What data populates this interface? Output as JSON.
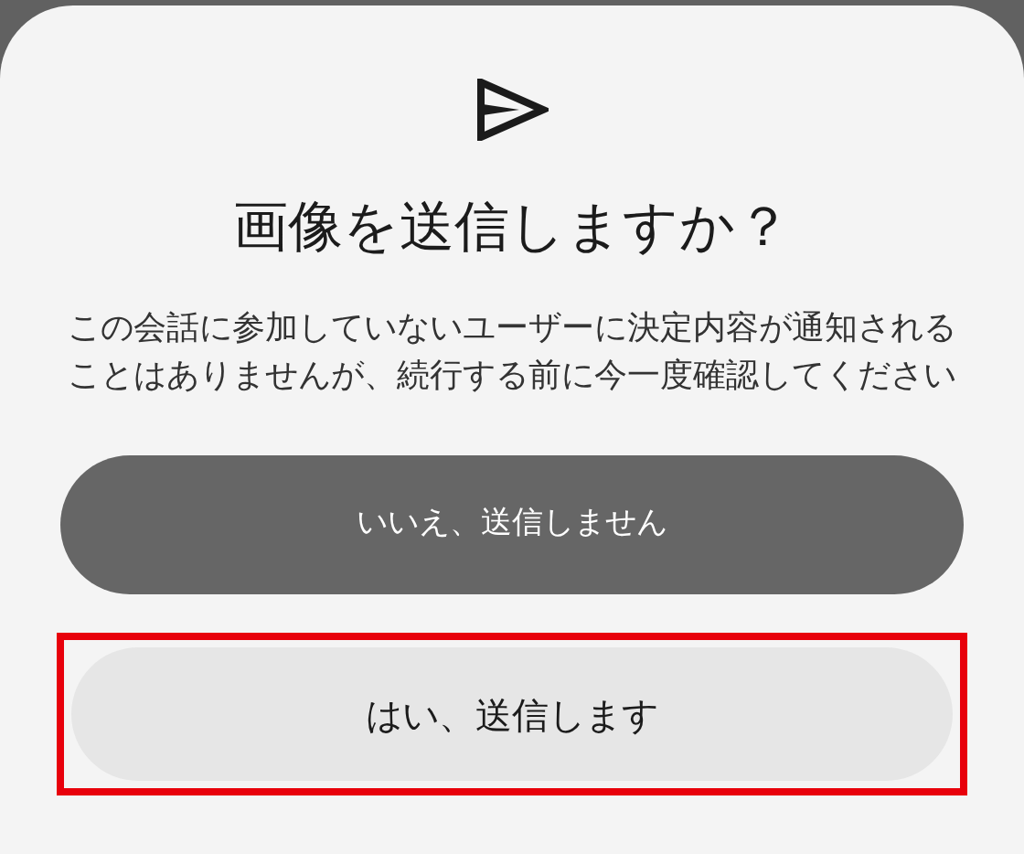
{
  "dialog": {
    "title": "画像を送信しますか？",
    "message": "この会話に参加していないユーザーに決定内容が通知されることはありませんが、続行する前に今一度確認してください",
    "buttons": [
      {
        "label": "いいえ、送信しません",
        "kind": "dark",
        "highlighted": false
      },
      {
        "label": "はい、送信します",
        "kind": "light",
        "highlighted": true
      }
    ]
  }
}
